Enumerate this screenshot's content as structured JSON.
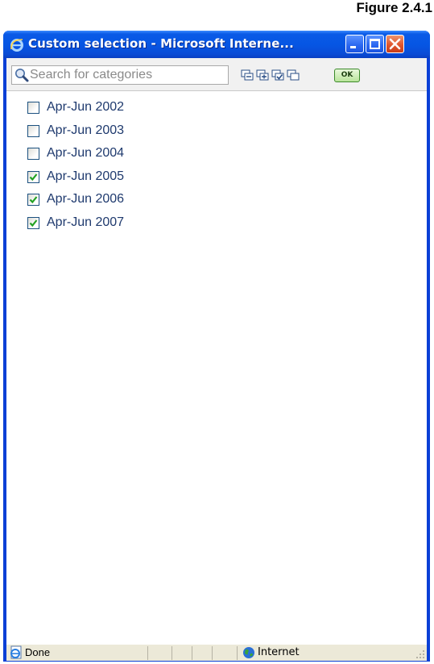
{
  "figure_caption": "Figure 2.4.1",
  "window": {
    "title": "Custom selection - Microsoft Interne...",
    "buttons": {
      "minimize": "minimize",
      "maximize": "maximize",
      "close": "close"
    }
  },
  "toolbar": {
    "search_placeholder": "Search for categories",
    "tool_icons": [
      "collapse-all-icon",
      "expand-all-icon",
      "select-all-icon",
      "deselect-all-icon"
    ],
    "ok_label": "OK"
  },
  "categories": [
    {
      "label": "Apr-Jun 2002",
      "checked": false
    },
    {
      "label": "Apr-Jun 2003",
      "checked": false
    },
    {
      "label": "Apr-Jun 2004",
      "checked": false
    },
    {
      "label": "Apr-Jun 2005",
      "checked": true
    },
    {
      "label": "Apr-Jun 2006",
      "checked": true
    },
    {
      "label": "Apr-Jun 2007",
      "checked": true
    }
  ],
  "statusbar": {
    "status": "Done",
    "zone": "Internet"
  },
  "colors": {
    "titlebar": "#0656e4",
    "close_button": "#e0552d",
    "check_mark": "#21a121",
    "label_text": "#1f3a6e"
  }
}
